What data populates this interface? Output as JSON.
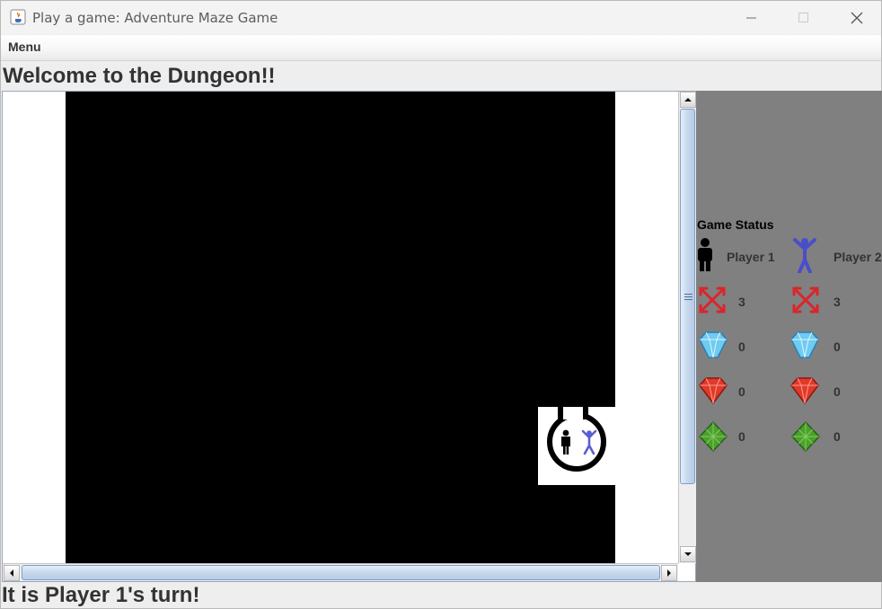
{
  "window": {
    "title": "Play a game: Adventure Maze Game",
    "controls": [
      "minimize",
      "maximize",
      "close"
    ]
  },
  "menu": {
    "items": [
      "Menu"
    ]
  },
  "header": {
    "welcome": "Welcome to the Dungeon!!"
  },
  "status": {
    "title": "Game Status",
    "players": [
      {
        "name": "Player 1",
        "icon": "player-1-icon",
        "color": "#000000",
        "arrows": "3",
        "blue_gems": "0",
        "red_gems": "0",
        "green_gems": "0"
      },
      {
        "name": "Player 2",
        "icon": "player-2-icon",
        "color": "#5a5ed0",
        "arrows": "3",
        "blue_gems": "0",
        "red_gems": "0",
        "green_gems": "0"
      }
    ]
  },
  "icons": {
    "arrow": "crossed-arrows-icon",
    "blue_gem": "blue-gem-icon",
    "red_gem": "red-gem-icon",
    "green_gem": "green-gem-icon"
  },
  "colors": {
    "maze_background": "#000000",
    "panel_background": "#808080",
    "arrow_red": "#d9262b",
    "gem_blue": "#6ecbf2",
    "gem_red": "#e03a2a",
    "gem_green": "#4ca02b"
  },
  "footer": {
    "turn_message": "It is Player 1's turn!"
  }
}
